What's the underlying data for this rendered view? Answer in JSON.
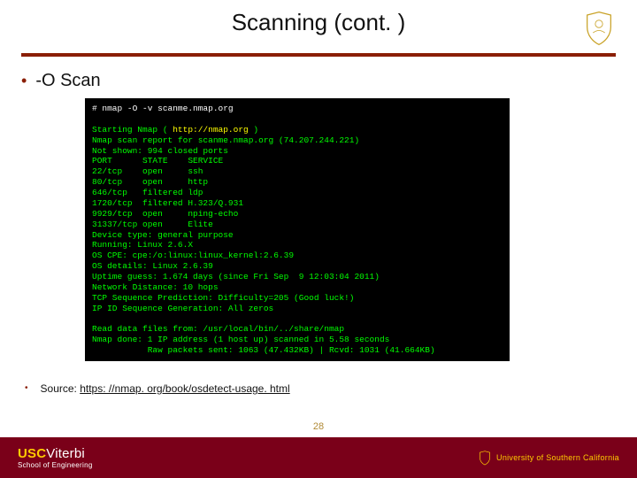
{
  "title": "Scanning (cont. )",
  "bullet1": "-O Scan",
  "terminal": {
    "cmd_prompt": "# ",
    "cmd": "nmap -O -v scanme.nmap.org",
    "line_start1": "Starting Nmap ( ",
    "url": "http://nmap.org",
    "line_start2": " )",
    "report": "Nmap scan report for scanme.nmap.org (74.207.244.221)",
    "notshown": "Not shown: 994 closed ports",
    "hdr": "PORT      STATE    SERVICE",
    "r1": "22/tcp    open     ssh",
    "r2": "80/tcp    open     http",
    "r3": "646/tcp   filtered ldp",
    "r4": "1720/tcp  filtered H.323/Q.931",
    "r5": "9929/tcp  open     nping-echo",
    "r6": "31337/tcp open     Elite",
    "dev": "Device type: general purpose",
    "run": "Running: Linux 2.6.X",
    "cpe": "OS CPE: cpe:/o:linux:linux_kernel:2.6.39",
    "osd": "OS details: Linux 2.6.39",
    "up": "Uptime guess: 1.674 days (since Fri Sep  9 12:03:04 2011)",
    "net": "Network Distance: 10 hops",
    "seq": "TCP Sequence Prediction: Difficulty=205 (Good luck!)",
    "ipid": "IP ID Sequence Generation: All zeros",
    "blank": "",
    "read": "Read data files from: /usr/local/bin/../share/nmap",
    "done": "Nmap done: 1 IP address (1 host up) scanned in 5.58 seconds",
    "raw": "           Raw packets sent: 1063 (47.432KB) | Rcvd: 1031 (41.664KB)"
  },
  "source_label": "Source: ",
  "source_url": "https: //nmap. org/book/osdetect-usage. html",
  "footer": {
    "brand_usc": "USC",
    "brand_viterbi": "Viterbi",
    "school": "School of Engineering",
    "university": "University of Southern California"
  },
  "page_number": "28"
}
